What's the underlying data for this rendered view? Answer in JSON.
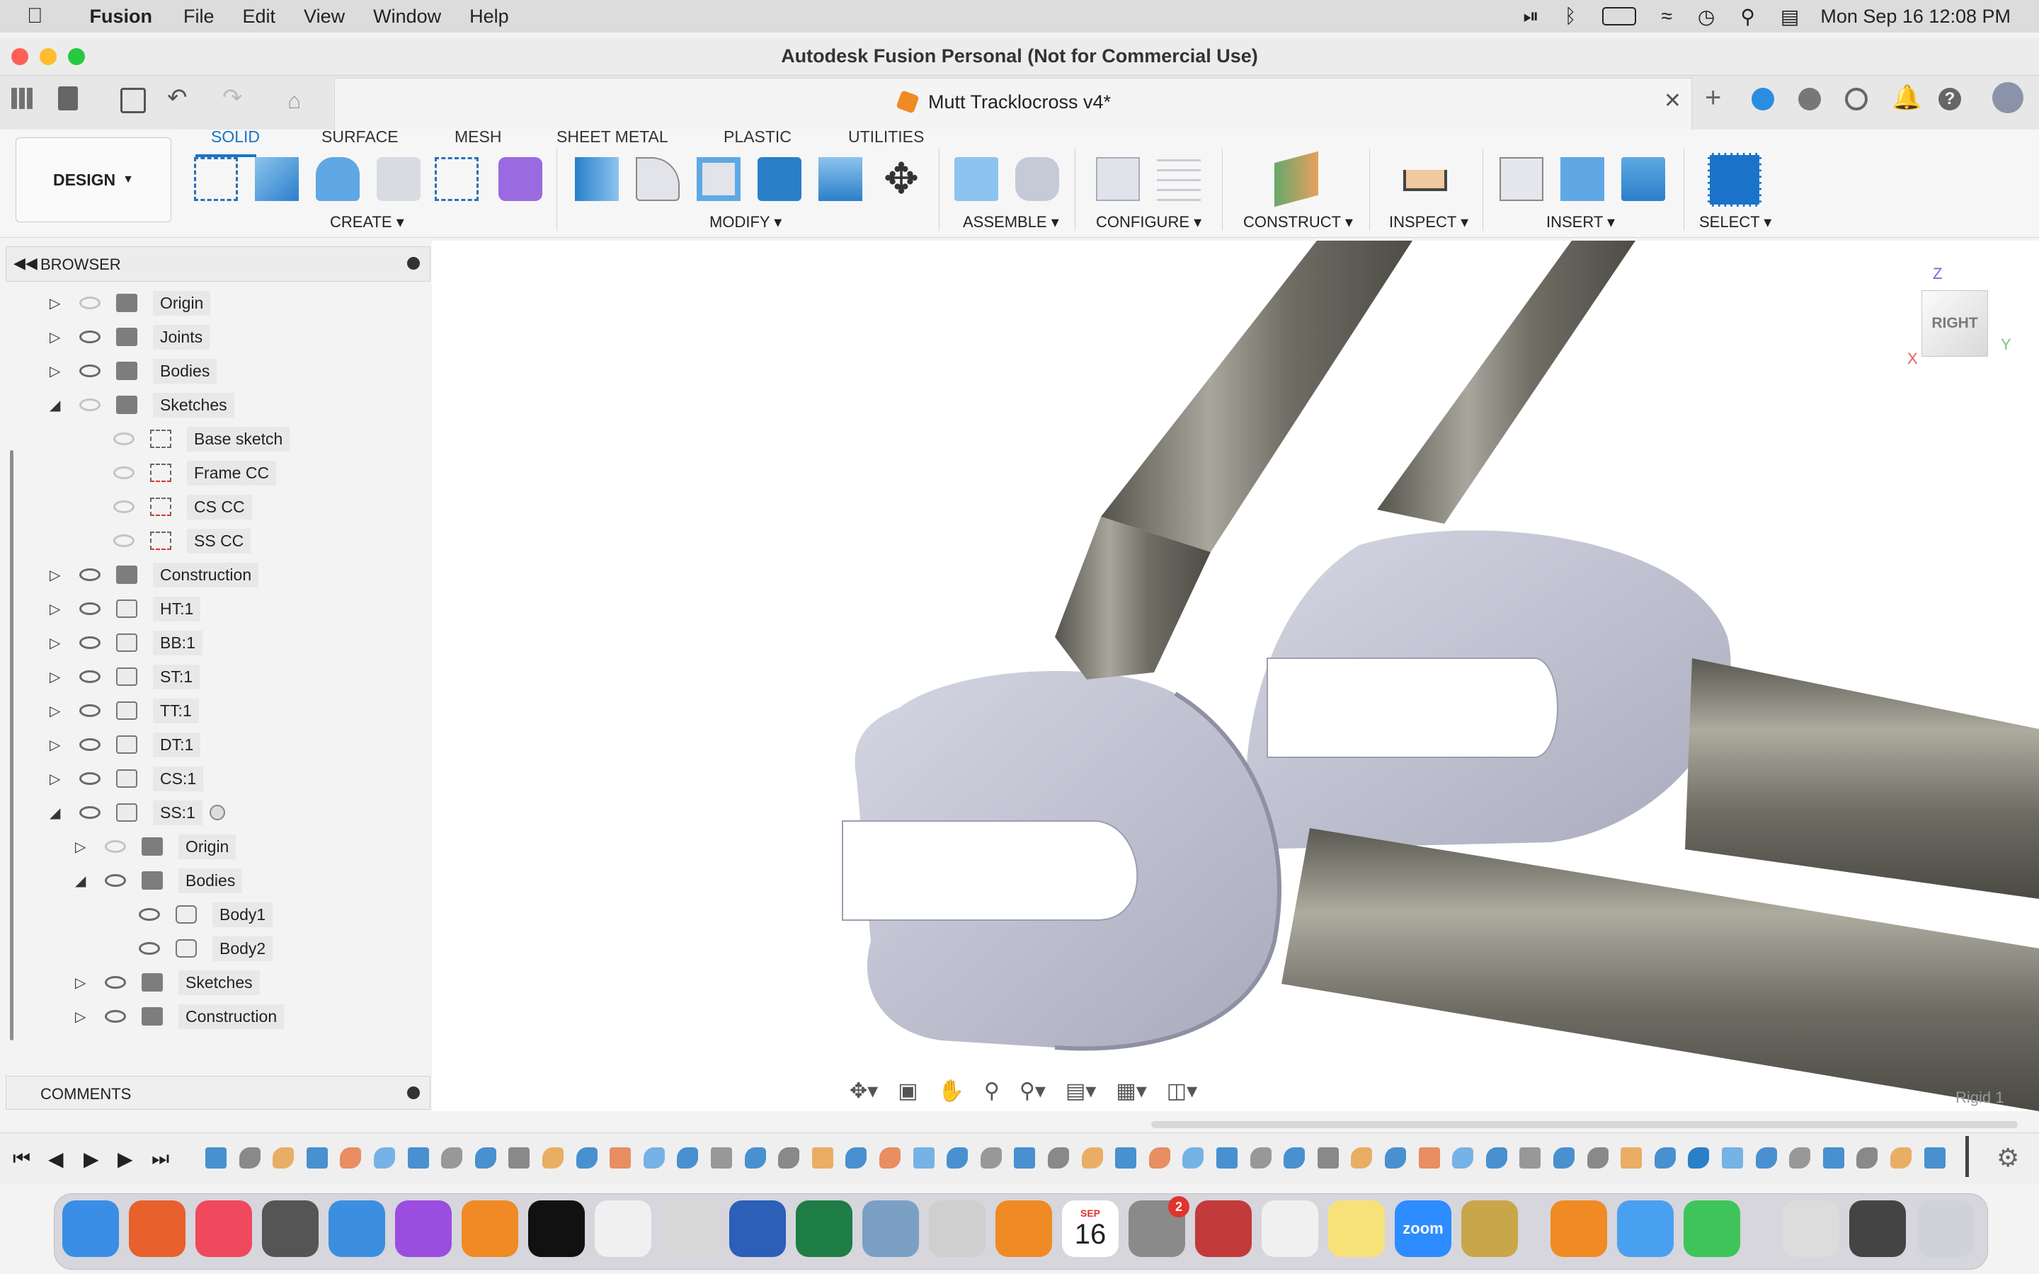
{
  "menubar": {
    "app_name": "Fusion",
    "items": [
      "File",
      "Edit",
      "View",
      "Window",
      "Help"
    ],
    "datetime": "Mon Sep 16  12:08 PM"
  },
  "window": {
    "title": "Autodesk Fusion Personal (Not for Commercial Use)"
  },
  "document_tab": {
    "title": "Mutt Tracklocross v4*"
  },
  "workspace_tabs": [
    "SOLID",
    "SURFACE",
    "MESH",
    "SHEET METAL",
    "PLASTIC",
    "UTILITIES"
  ],
  "design_button": "DESIGN",
  "toolbar_groups": [
    "CREATE",
    "MODIFY",
    "ASSEMBLE",
    "CONFIGURE",
    "CONSTRUCT",
    "INSPECT",
    "INSERT",
    "SELECT"
  ],
  "browser": {
    "title": "BROWSER",
    "items": [
      {
        "label": "Origin",
        "indent": 0,
        "expanded": false,
        "hidden": true,
        "icon": "folder-icon"
      },
      {
        "label": "Joints",
        "indent": 0,
        "expanded": false,
        "hidden": false,
        "icon": "folder-icon"
      },
      {
        "label": "Bodies",
        "indent": 0,
        "expanded": false,
        "hidden": false,
        "icon": "folder-icon"
      },
      {
        "label": "Sketches",
        "indent": 0,
        "expanded": true,
        "hidden": true,
        "icon": "folder-icon"
      },
      {
        "label": "Base sketch",
        "indent": 1,
        "leaf": true,
        "hidden": true,
        "icon": "sketch-icon"
      },
      {
        "label": "Frame CC",
        "indent": 1,
        "leaf": true,
        "hidden": true,
        "icon": "sketch-locked-icon"
      },
      {
        "label": "CS CC",
        "indent": 1,
        "leaf": true,
        "hidden": true,
        "icon": "sketch-locked-icon"
      },
      {
        "label": "SS CC",
        "indent": 1,
        "leaf": true,
        "hidden": true,
        "icon": "sketch-locked-icon"
      },
      {
        "label": "Construction",
        "indent": 0,
        "expanded": false,
        "hidden": false,
        "icon": "folder-icon"
      },
      {
        "label": "HT:1",
        "indent": 0,
        "expanded": false,
        "hidden": false,
        "icon": "component-joint-icon"
      },
      {
        "label": "BB:1",
        "indent": 0,
        "expanded": false,
        "hidden": false,
        "icon": "component-icon"
      },
      {
        "label": "ST:1",
        "indent": 0,
        "expanded": false,
        "hidden": false,
        "icon": "component-icon"
      },
      {
        "label": "TT:1",
        "indent": 0,
        "expanded": false,
        "hidden": false,
        "icon": "component-icon"
      },
      {
        "label": "DT:1",
        "indent": 0,
        "expanded": false,
        "hidden": false,
        "icon": "component-icon"
      },
      {
        "label": "CS:1",
        "indent": 0,
        "expanded": false,
        "hidden": false,
        "icon": "component-icon"
      },
      {
        "label": "SS:1",
        "indent": 0,
        "expanded": true,
        "hidden": false,
        "icon": "component-icon",
        "active": true
      },
      {
        "label": "Origin",
        "indent": 1,
        "expanded": false,
        "hidden": true,
        "icon": "folder-icon"
      },
      {
        "label": "Bodies",
        "indent": 1,
        "expanded": true,
        "hidden": false,
        "icon": "folder-icon"
      },
      {
        "label": "Body1",
        "indent": 2,
        "leaf": true,
        "hidden": false,
        "icon": "body-icon"
      },
      {
        "label": "Body2",
        "indent": 2,
        "leaf": true,
        "hidden": false,
        "icon": "body-icon"
      },
      {
        "label": "Sketches",
        "indent": 1,
        "expanded": false,
        "hidden": false,
        "icon": "folder-icon"
      },
      {
        "label": "Construction",
        "indent": 1,
        "expanded": false,
        "hidden": false,
        "icon": "folder-icon"
      }
    ]
  },
  "comments": {
    "title": "COMMENTS"
  },
  "viewcube": {
    "face": "RIGHT",
    "axis_z": "Z",
    "axis_y": "Y",
    "axis_x": "X"
  },
  "status": {
    "rigid": "Rigid 1"
  },
  "dock": {
    "calendar_month": "SEP",
    "calendar_day": "16",
    "badge_count": "2",
    "zoom_label": "zoom"
  },
  "colors": {
    "accent": "#1a73c8",
    "tube": "#6e6c63",
    "dropout": "#c7c9d8"
  }
}
